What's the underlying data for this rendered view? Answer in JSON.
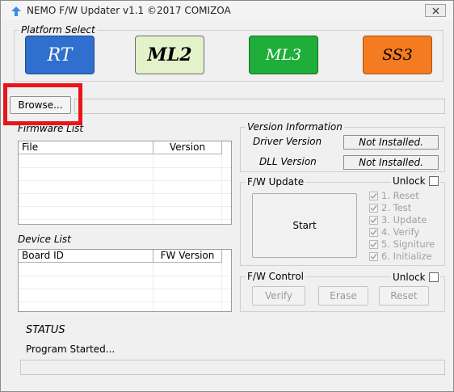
{
  "window": {
    "title": "NEMO F/W Updater v1.1 ©2017 COMIZOA",
    "close_label": "✕"
  },
  "platform": {
    "legend": "Platform Select",
    "buttons": [
      {
        "label": "RT",
        "color": "#2f6fce"
      },
      {
        "label": "ML2",
        "color": "#e4f2c9"
      },
      {
        "label": "ML3",
        "color": "#1fae3a"
      },
      {
        "label": "SS3",
        "color": "#f47b1f"
      }
    ]
  },
  "browse": {
    "label": "Browse...",
    "path_value": ""
  },
  "firmware_list": {
    "legend": "Firmware List",
    "columns": [
      "File",
      "Version"
    ]
  },
  "device_list": {
    "legend": "Device List",
    "columns": [
      "Board ID",
      "FW Version"
    ]
  },
  "version_info": {
    "legend": "Version Information",
    "driver_label": "Driver Version",
    "driver_value": "Not Installed.",
    "dll_label": "DLL Version",
    "dll_value": "Not Installed."
  },
  "fw_update": {
    "legend": "F/W Update",
    "unlock_label": "Unlock",
    "start_label": "Start",
    "steps": [
      "1. Reset",
      "2. Test",
      "3. Update",
      "4. Verify",
      "5. Signiture",
      "6. Initialize"
    ]
  },
  "fw_control": {
    "legend": "F/W Control",
    "unlock_label": "Unlock",
    "verify_label": "Verify",
    "erase_label": "Erase",
    "reset_label": "Reset"
  },
  "status": {
    "heading": "STATUS",
    "message": "Program Started..."
  },
  "colors": {
    "highlight": "#e8151b"
  }
}
